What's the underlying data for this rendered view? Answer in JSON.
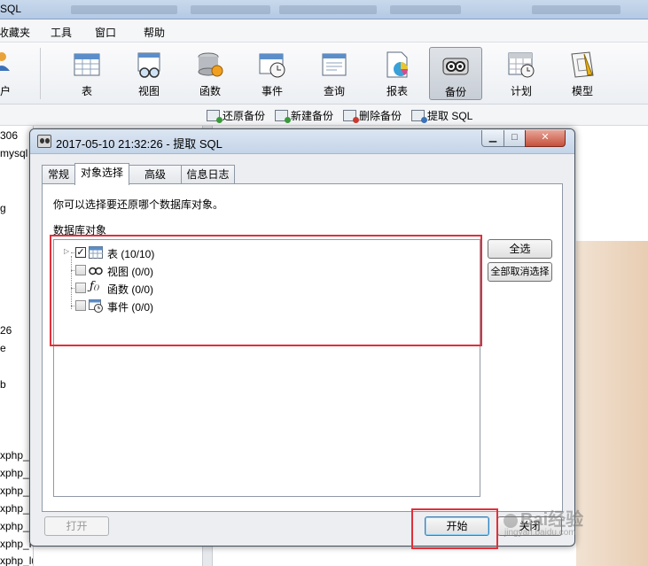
{
  "app": {
    "title": "SQL"
  },
  "menubar": {
    "items": [
      "收藏夹",
      "工具",
      "窗口",
      "帮助"
    ]
  },
  "toolbar": {
    "left_label": "户",
    "buttons": [
      {
        "label": "表",
        "icon": "table-icon"
      },
      {
        "label": "视图",
        "icon": "view-icon"
      },
      {
        "label": "函数",
        "icon": "function-icon"
      },
      {
        "label": "事件",
        "icon": "event-icon"
      },
      {
        "label": "查询",
        "icon": "query-icon"
      },
      {
        "label": "报表",
        "icon": "report-icon"
      },
      {
        "label": "备份",
        "icon": "backup-icon",
        "active": true
      },
      {
        "label": "计划",
        "icon": "schedule-icon"
      },
      {
        "label": "模型",
        "icon": "model-icon"
      }
    ]
  },
  "subtoolbar": {
    "items": [
      {
        "label": "还原备份",
        "icon": "restore-backup-icon"
      },
      {
        "label": "新建备份",
        "icon": "new-backup-icon"
      },
      {
        "label": "删除备份",
        "icon": "delete-backup-icon"
      },
      {
        "label": "提取 SQL",
        "icon": "extract-sql-icon"
      }
    ]
  },
  "left_panel": {
    "items": [
      "306",
      "mysql",
      "",
      "g",
      "",
      "",
      "",
      "",
      "",
      "26",
      "e",
      "",
      "b",
      "",
      "",
      "",
      "",
      "xphp_a",
      "xphp_",
      "xphp_c",
      "xphp_i",
      "xphp_l",
      "xphp_l",
      "xphp_lunbo"
    ]
  },
  "dialog": {
    "title": "2017-05-10 21:32:26 - 提取 SQL",
    "tabs": [
      "常规",
      "对象选择",
      "高级",
      "信息日志"
    ],
    "selected_tab": "对象选择",
    "description": "你可以选择要还原哪个数据库对象。",
    "group_label": "数据库对象",
    "tree": [
      {
        "label": "表 (10/10)",
        "checked": true,
        "icon": "table-icon",
        "expandable": true
      },
      {
        "label": "视图 (0/0)",
        "checked": false,
        "icon": "view-icon"
      },
      {
        "label": "函数 (0/0)",
        "checked": false,
        "icon": "function-icon"
      },
      {
        "label": "事件 (0/0)",
        "checked": false,
        "icon": "event-icon"
      }
    ],
    "buttons": {
      "select_all": "全选",
      "deselect_all": "全部取消选择",
      "open": "打开",
      "start": "开始",
      "close": "关闭"
    }
  },
  "watermark": {
    "text": "Bai经验",
    "sub": "jingyan.baidu.com"
  },
  "colors": {
    "highlight": "#e0303a",
    "accent": "#3c7fb1"
  }
}
